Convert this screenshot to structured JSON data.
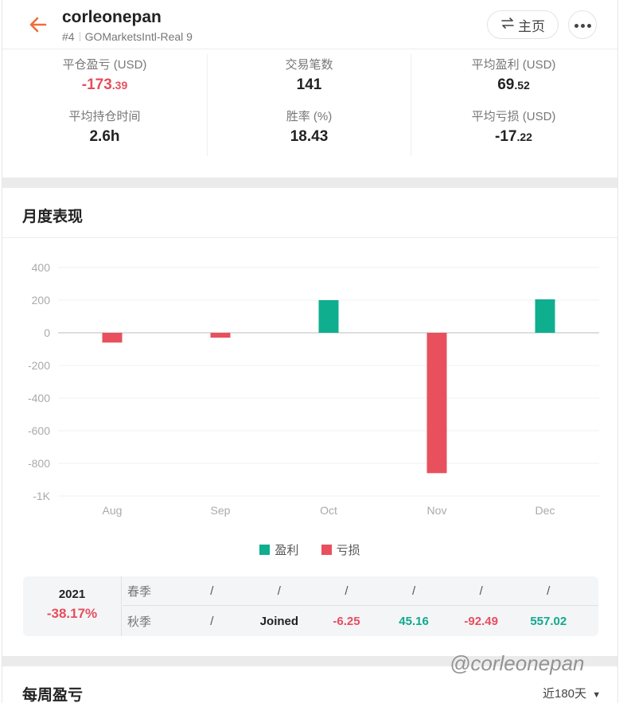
{
  "header": {
    "title": "corleonepan",
    "rank": "#4",
    "account": "GOMarketsIntl-Real 9",
    "home_label": "主页"
  },
  "stats": {
    "closed_pnl": {
      "label": "平仓盈亏 (USD)",
      "int": "-173",
      "dec": ".39"
    },
    "trades": {
      "label": "交易笔数",
      "value": "141"
    },
    "avg_profit": {
      "label": "平均盈利 (USD)",
      "int": "69",
      "dec": ".52"
    },
    "avg_hold": {
      "label": "平均持仓时间",
      "value": "2.6h"
    },
    "win_rate": {
      "label": "胜率 (%)",
      "value": "18.43"
    },
    "avg_loss": {
      "label": "平均亏损 (USD)",
      "int": "-17",
      "dec": ".22"
    }
  },
  "monthly": {
    "title": "月度表现"
  },
  "chart_data": {
    "type": "bar",
    "categories": [
      "Aug",
      "Sep",
      "Oct",
      "Nov",
      "Dec"
    ],
    "values": [
      -60,
      -30,
      200,
      -860,
      205
    ],
    "y_ticks": [
      "400",
      "200",
      "0",
      "-200",
      "-400",
      "-600",
      "-800",
      "-1K"
    ],
    "ylim": [
      -1000,
      400
    ],
    "grid": true,
    "legend": [
      {
        "name": "盈利",
        "color": "#0fae8f"
      },
      {
        "name": "亏损",
        "color": "#e8505e"
      }
    ],
    "colors": {
      "profit": "#0fae8f",
      "loss": "#e8505e"
    }
  },
  "season": {
    "year": "2021",
    "ytd": "-38.17%",
    "rows": [
      {
        "name": "春季",
        "cells": [
          "/",
          "/",
          "/",
          "/",
          "/",
          "/"
        ]
      },
      {
        "name": "秋季",
        "cells": [
          "/",
          "Joined",
          "-6.25",
          "45.16",
          "-92.49",
          "557.02"
        ]
      }
    ]
  },
  "weekly": {
    "title": "每周盈亏",
    "range": "近180天"
  },
  "watermark": "@corleonepan"
}
